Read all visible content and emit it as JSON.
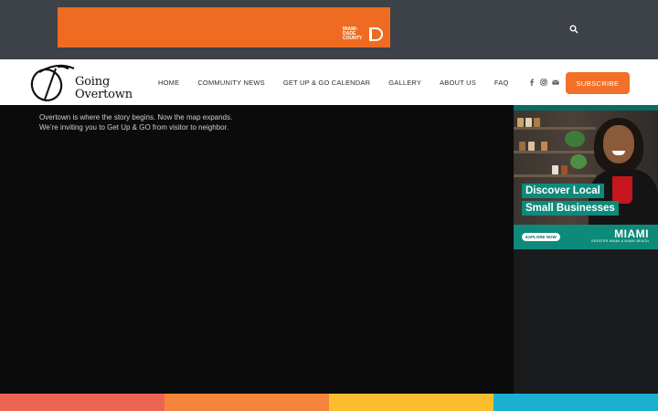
{
  "top_banner": {
    "logo_text": "MIAMI-DADE COUNTY",
    "background": "#ef6b22"
  },
  "header": {
    "logo_line1": "Going",
    "logo_line2": "Overtown",
    "nav": [
      "HOME",
      "COMMUNITY NEWS",
      "GET UP & GO CALENDAR",
      "GALLERY",
      "ABOUT US",
      "FAQ"
    ],
    "socials": [
      "facebook-icon",
      "instagram-icon",
      "envelope-icon"
    ],
    "subscribe_label": "SUBSCRIBE"
  },
  "main": {
    "intro_line1": "Overtown is where the story begins. Now the map expands.",
    "intro_line2": "We’re inviting you to Get Up & GO from visitor to neighbor."
  },
  "ad": {
    "headline_line1": "Discover Local",
    "headline_line2": "Small Businesses",
    "button_label": "EXPLORE NOW",
    "brand": "MIAMI",
    "brand_sub": "GREATER MIAMI & MIAMI BEACH"
  },
  "colors": {
    "accent": "#f2702a",
    "topbar": "#3d4148",
    "ad_teal": "#0e8a7b",
    "stripes": [
      "#ec6553",
      "#f5853c",
      "#fbbd2e",
      "#1bb0d0"
    ]
  }
}
